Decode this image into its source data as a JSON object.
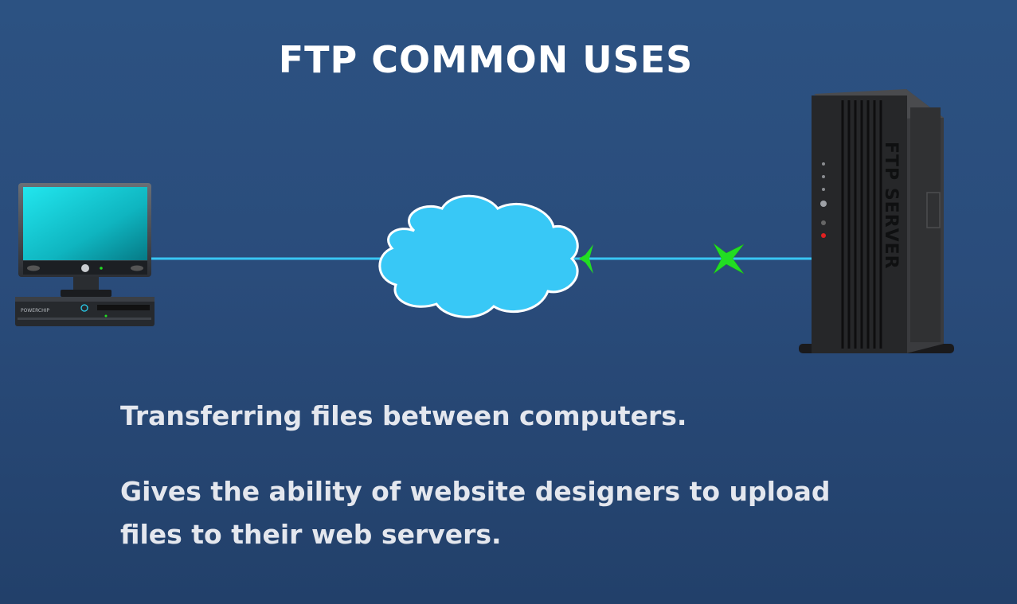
{
  "slide": {
    "title": "FTP COMMON USES",
    "background_color": "#2a4c7b",
    "bullets": [
      "Transferring files between computers.",
      "Gives the ability of website designers to upload files to their web servers."
    ]
  },
  "diagram": {
    "nodes": [
      {
        "name": "computer",
        "icon": "desktop-computer-icon"
      },
      {
        "name": "internet",
        "icon": "cloud-icon"
      },
      {
        "name": "server",
        "icon": "server-tower-icon",
        "label": "FTP SERVER"
      }
    ],
    "computer_brand": "POWERCHIP",
    "link_color": "#38c6f4",
    "marker_color": "#22dd22",
    "cloud_color": "#38c8f6"
  }
}
